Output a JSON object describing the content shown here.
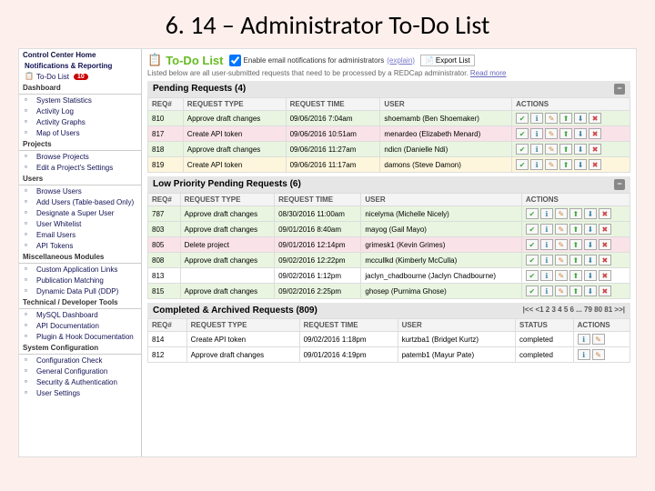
{
  "title": "6. 14 – Administrator To-Do List",
  "sidebar": {
    "top": "Control Center Home",
    "notif_section": "Notifications & Reporting",
    "todo_item": "To-Do List",
    "todo_badge": "10",
    "dashboard_section": "Dashboard",
    "dash_items": [
      "System Statistics",
      "Activity Log",
      "Activity Graphs",
      "Map of Users"
    ],
    "projects_section": "Projects",
    "proj_items": [
      "Browse Projects",
      "Edit a Project's Settings"
    ],
    "users_section": "Users",
    "user_items": [
      "Browse Users",
      "Add Users (Table-based Only)",
      "Designate a Super User",
      "User Whitelist",
      "Email Users",
      "API Tokens"
    ],
    "misc_section": "Miscellaneous Modules",
    "misc_items": [
      "Custom Application Links",
      "Publication Matching",
      "Dynamic Data Pull (DDP)"
    ],
    "tech_section": "Technical / Developer Tools",
    "tech_items": [
      "MySQL Dashboard",
      "API Documentation",
      "Plugin & Hook Documentation"
    ],
    "sys_section": "System Configuration",
    "sys_items": [
      "Configuration Check",
      "General Configuration",
      "Security & Authentication",
      "User Settings"
    ]
  },
  "header": {
    "page_title": "To-Do List",
    "checkbox_label": "Enable email notifications for administrators",
    "explain": "(explain)",
    "export_label": "Export List",
    "desc_prefix": "Listed below are all user-submitted requests that need to be processed by a REDCap administrator.",
    "readmore": "Read more"
  },
  "cols": {
    "req": "REQ#",
    "type": "REQUEST TYPE",
    "time": "REQUEST TIME",
    "user": "USER",
    "actions": "ACTIONS",
    "status": "STATUS"
  },
  "pending": {
    "title": "Pending Requests (4)",
    "rows": [
      {
        "cls": "green",
        "req": "810",
        "type": "Approve draft changes",
        "time": "09/06/2016 7:04am",
        "user": "shoemamb (Ben Shoemaker)"
      },
      {
        "cls": "pink",
        "req": "817",
        "type": "Create API token",
        "time": "09/06/2016 10:51am",
        "user": "menardeo (Elizabeth Menard)"
      },
      {
        "cls": "green",
        "req": "818",
        "type": "Approve draft changes",
        "time": "09/06/2016 11:27am",
        "user": "ndicn (Danielle Ndi)"
      },
      {
        "cls": "yellow",
        "req": "819",
        "type": "Create API token",
        "time": "09/06/2016 11:17am",
        "user": "damons (Steve Damon)"
      }
    ]
  },
  "lowpri": {
    "title": "Low Priority Pending Requests (6)",
    "rows": [
      {
        "cls": "green",
        "req": "787",
        "type": "Approve draft changes",
        "time": "08/30/2016 11:00am",
        "user": "nicelyma (Michelle Nicely)"
      },
      {
        "cls": "green",
        "req": "803",
        "type": "Approve draft changes",
        "time": "09/01/2016 8:40am",
        "user": "mayog (Gail Mayo)"
      },
      {
        "cls": "pink",
        "req": "805",
        "type": "Delete project",
        "time": "09/01/2016 12:14pm",
        "user": "grimesk1 (Kevin Grimes)"
      },
      {
        "cls": "green",
        "req": "808",
        "type": "Approve draft changes",
        "time": "09/02/2016 12:22pm",
        "user": "mccullkd (Kimberly McCulla)"
      },
      {
        "cls": "white",
        "req": "813",
        "type": "",
        "time": "09/02/2016 1:12pm",
        "user": "jaclyn_chadbourne (Jaclyn Chadbourne)"
      },
      {
        "cls": "green",
        "req": "815",
        "type": "Approve draft changes",
        "time": "09/02/2016 2:25pm",
        "user": "ghosep (Purnima Ghose)"
      }
    ]
  },
  "completed": {
    "title": "Completed & Archived Requests (809)",
    "pager": "|<< <1 2 3 4 5 6 ... 79 80 81 >>|",
    "rows": [
      {
        "cls": "white",
        "req": "814",
        "type": "Create API token",
        "time": "09/02/2016 1:18pm",
        "user": "kurtzba1 (Bridget Kurtz)",
        "status": "completed"
      },
      {
        "cls": "white",
        "req": "812",
        "type": "Approve draft changes",
        "time": "09/01/2016 4:19pm",
        "user": "patemb1 (Mayur Pate)",
        "status": "completed"
      }
    ]
  }
}
